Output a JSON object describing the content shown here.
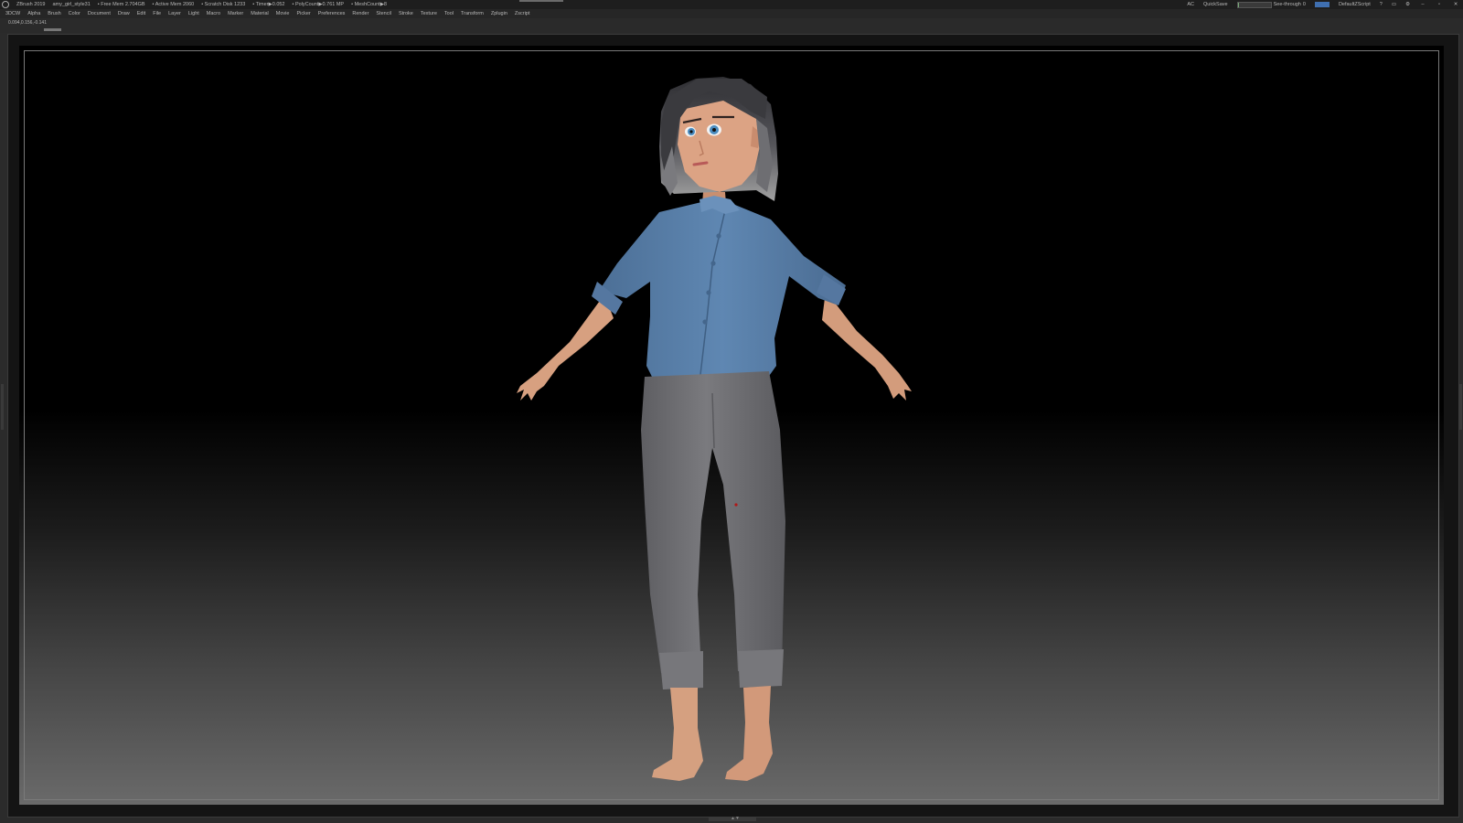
{
  "titlebar": {
    "app": "ZBrush 2019",
    "document": "amy_girl_style31",
    "free_mem": "• Free Mem 2.704GB",
    "active_mem": "• Active Mem 2060",
    "scratch_disk": "• Scratch Disk 1233",
    "timer": "• Timer▶0.052",
    "polycount": "• PolyCount▶0.761 MP",
    "meshcount": "• MeshCount▶8",
    "ac": "AC",
    "quicksave": "QuickSave",
    "see_through_label": "See-through",
    "see_through_value": "0",
    "script_name": "DefaultZScript",
    "see_through_level": 0
  },
  "menu": {
    "items": [
      "3DCW",
      "Alpha",
      "Brush",
      "Color",
      "Document",
      "Draw",
      "Edit",
      "File",
      "Layer",
      "Light",
      "Macro",
      "Marker",
      "Material",
      "Movie",
      "Picker",
      "Preferences",
      "Render",
      "Stencil",
      "Stroke",
      "Texture",
      "Tool",
      "Transform",
      "Zplugin",
      "Zscript"
    ]
  },
  "info": {
    "coords": "0.094,0.156,-0.141"
  },
  "colors": {
    "shirt": "#5b82ad",
    "pants": "#707074",
    "skin": "#d9a080",
    "hair_dark": "#2f2f33",
    "hair_light": "#9a9a9a",
    "background_top": "#000000",
    "background_bottom": "#6a6a6a"
  }
}
